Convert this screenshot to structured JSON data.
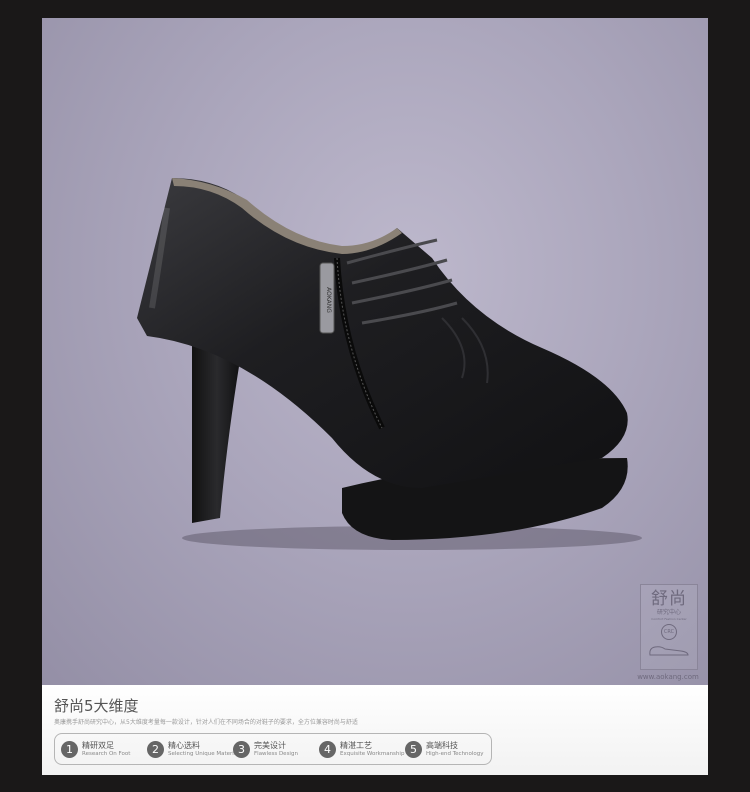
{
  "badge": {
    "title": "舒尚",
    "subtitle": "研究中心",
    "subtitle_en": "Comfort Fashion Center",
    "circle_label": "CRC"
  },
  "site_url": "www.aokang.com",
  "zipper_brand": "AOKANG",
  "panel": {
    "title": "舒尚5大维度",
    "description": "奥康携手舒尚研究中心，从5大维度考量每一款设计，针对人们在不同场合的对鞋子的要求，全方位兼容时尚与舒适",
    "steps": [
      {
        "num": "1",
        "cn": "精研双足",
        "en": "Research On Foot"
      },
      {
        "num": "2",
        "cn": "精心选料",
        "en": "Selecting Unique Materials"
      },
      {
        "num": "3",
        "cn": "完美设计",
        "en": "Flawless Design"
      },
      {
        "num": "4",
        "cn": "精湛工艺",
        "en": "Exquisite Workmanship"
      },
      {
        "num": "5",
        "cn": "高端科技",
        "en": "High-end Technology"
      }
    ]
  },
  "colors": {
    "background_dark": "#1a1818",
    "photo_bg": "#aba6bc",
    "shoe_black": "#1c1c1e",
    "panel_white": "#ffffff",
    "step_circle": "#666666"
  }
}
